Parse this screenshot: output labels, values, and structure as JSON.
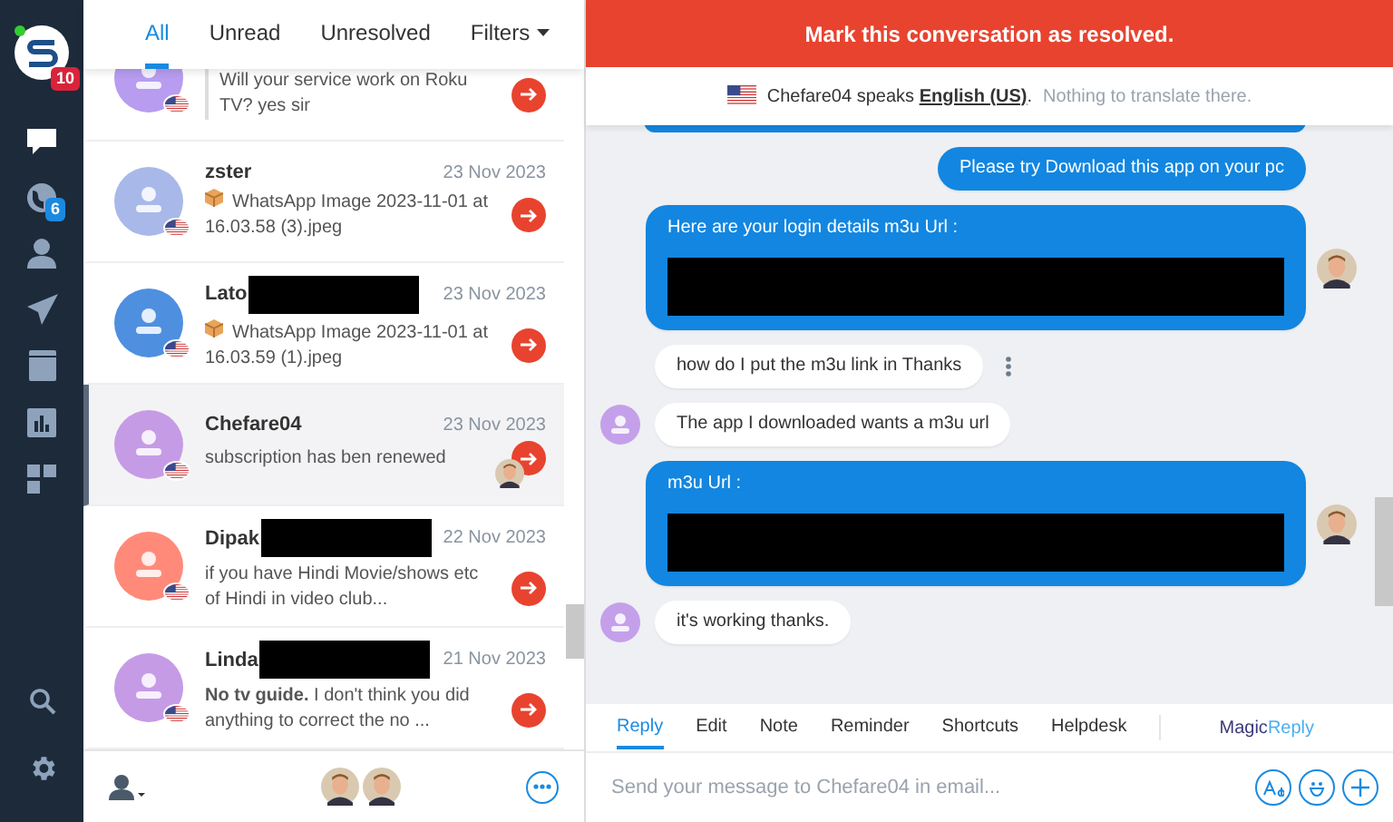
{
  "sidebar": {
    "logo_badge": "10",
    "items": [
      {
        "selected": true
      },
      {
        "selected": false,
        "badge": "6"
      },
      {
        "selected": false
      },
      {
        "selected": false
      },
      {
        "selected": false
      },
      {
        "selected": false
      },
      {
        "selected": false
      }
    ]
  },
  "list_tabs": [
    {
      "label": "All",
      "selected": true
    },
    {
      "label": "Unread",
      "selected": false
    },
    {
      "label": "Unresolved",
      "selected": false
    },
    {
      "label": "Filters",
      "selected": false,
      "dropdown": true
    }
  ],
  "conversations": [
    {
      "preview": "Will your service work on Roku TV? yes sir",
      "quoted": true,
      "selected": false,
      "color": "#b79cf0"
    },
    {
      "name": "zster",
      "date": "23 Nov 2023",
      "preview": "WhatsApp Image 2023-11-01 at 16.03.58 (3).jpeg",
      "attachment": true,
      "selected": false,
      "color": "#a8b8e8"
    },
    {
      "name": "Lato",
      "date": "23 Nov 2023",
      "preview": "WhatsApp Image 2023-11-01 at 16.03.59 (1).jpeg",
      "attachment": true,
      "redacted": true,
      "selected": false,
      "color": "#4f8fe0"
    },
    {
      "name": "Chefare04",
      "date": "23 Nov 2023",
      "preview": "subscription has ben renewed",
      "selected": true,
      "color": "#c69be6",
      "agent_avatar": true
    },
    {
      "name": "Dipak",
      "date": "22 Nov 2023",
      "preview": "if you have Hindi Movie/shows etc of Hindi in video club...",
      "redacted": true,
      "selected": false,
      "color": "#ff8a7a"
    },
    {
      "name": "Linda",
      "date": "21 Nov 2023",
      "preview": "**No tv guide.** I don't think you did anything to correct the no ...",
      "redacted": true,
      "selected": false,
      "color": "#c69be6"
    }
  ],
  "banner": "Mark this conversation as resolved.",
  "translation": {
    "text": "Chefare04 speaks **English (US)**.",
    "note": "Nothing to translate there."
  },
  "messages": [
    {
      "kind": "cut"
    },
    {
      "kind": "agent",
      "text": "Please try Download this app on your pc"
    },
    {
      "kind": "agent",
      "text": "Here are your login details m3u Url :",
      "redacted": true,
      "avatar": true
    },
    {
      "kind": "customer",
      "text": "how do I put the m3u link in Thanks",
      "menu": true
    },
    {
      "kind": "customer",
      "text": "The app I downloaded wants a m3u url",
      "avatar": true
    },
    {
      "kind": "agent",
      "text": "m3u Url :",
      "redacted": true,
      "avatar": true
    },
    {
      "kind": "customer",
      "text": "it's working thanks.",
      "avatar": true
    }
  ],
  "compose_tabs": [
    {
      "label": "Reply",
      "selected": true
    },
    {
      "label": "Edit",
      "selected": false
    },
    {
      "label": "Note",
      "selected": false
    },
    {
      "label": "Reminder",
      "selected": false
    },
    {
      "label": "Shortcuts",
      "selected": false
    },
    {
      "label": "Helpdesk",
      "selected": false
    }
  ],
  "magic_reply": {
    "part_1": "Magic",
    "part_2": "Reply"
  },
  "compose": {
    "placeholder": "Send your message to Chefare04 in email..."
  }
}
